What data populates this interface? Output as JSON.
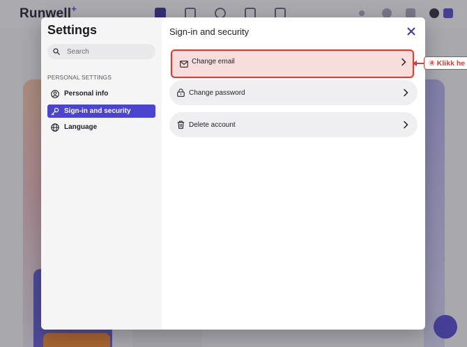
{
  "background": {
    "logo": "Runwell",
    "logo_plus": "+"
  },
  "modal": {
    "sidebar": {
      "title": "Settings",
      "search_placeholder": "Search",
      "section_label": "Personal settings",
      "items": [
        {
          "label": "Personal info",
          "icon": "user-circle-icon",
          "active": false
        },
        {
          "label": "Sign-in and security",
          "icon": "key-icon",
          "active": true
        },
        {
          "label": "Language",
          "icon": "globe-icon",
          "active": false
        }
      ]
    },
    "main": {
      "title": "Sign-in and security",
      "rows": [
        {
          "label": "Change email",
          "icon": "envelope-icon",
          "highlighted": true
        },
        {
          "label": "Change password",
          "icon": "lock-icon",
          "highlighted": false
        },
        {
          "label": "Delete account",
          "icon": "trash-icon",
          "highlighted": false
        }
      ]
    }
  },
  "annotation": {
    "label": "④ Klikk he"
  },
  "colors": {
    "accent": "#4b44cf",
    "annotation_red": "#de3b32",
    "highlight_fill": "#f7dedd"
  }
}
